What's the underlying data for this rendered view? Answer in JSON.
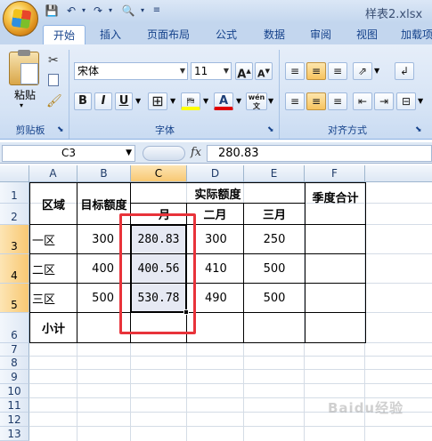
{
  "app": {
    "doc_title": "样表2.xlsx",
    "quick_access": [
      "save-icon",
      "undo-icon",
      "redo-icon",
      "print-preview-icon",
      "customize-icon"
    ]
  },
  "ribbon": {
    "tabs": [
      "开始",
      "插入",
      "页面布局",
      "公式",
      "数据",
      "审阅",
      "视图",
      "加载项"
    ],
    "active_tab": "开始",
    "clipboard": {
      "paste_label": "粘贴",
      "group_label": "剪贴板"
    },
    "font": {
      "font_name": "宋体",
      "font_size": "11",
      "bold": "B",
      "italic": "I",
      "underline": "U",
      "grow_label": "A",
      "shrink_label": "A",
      "font_color_label": "A",
      "phonetic_label": "wén",
      "group_label": "字体"
    },
    "alignment": {
      "group_label": "对齐方式"
    }
  },
  "formula_bar": {
    "name_box": "C3",
    "fx_label": "fx",
    "formula": "280.83"
  },
  "sheet": {
    "columns": [
      "A",
      "B",
      "C",
      "D",
      "E",
      "F"
    ],
    "selected_column": "C",
    "rows": [
      "1",
      "2",
      "3",
      "4",
      "5",
      "6",
      "7",
      "8",
      "9",
      "10",
      "11",
      "12",
      "13"
    ],
    "selected_rows": [
      "3",
      "4",
      "5"
    ],
    "cells": {
      "a1": "区域",
      "b1": "目标额度",
      "c1": "实际额度",
      "f1": "季度合计",
      "c2": "一月",
      "d2": "二月",
      "e2": "三月",
      "a3": "一区",
      "b3": "300",
      "c3": "280.83",
      "d3": "300",
      "e3": "250",
      "a4": "二区",
      "b4": "400",
      "c4": "400.56",
      "d4": "410",
      "e4": "500",
      "a5": "三区",
      "b5": "500",
      "c5": "530.78",
      "d5": "490",
      "e5": "500",
      "a6": "小计"
    },
    "highlight_color": "#e8333a",
    "watermark": "Baidu经验"
  }
}
